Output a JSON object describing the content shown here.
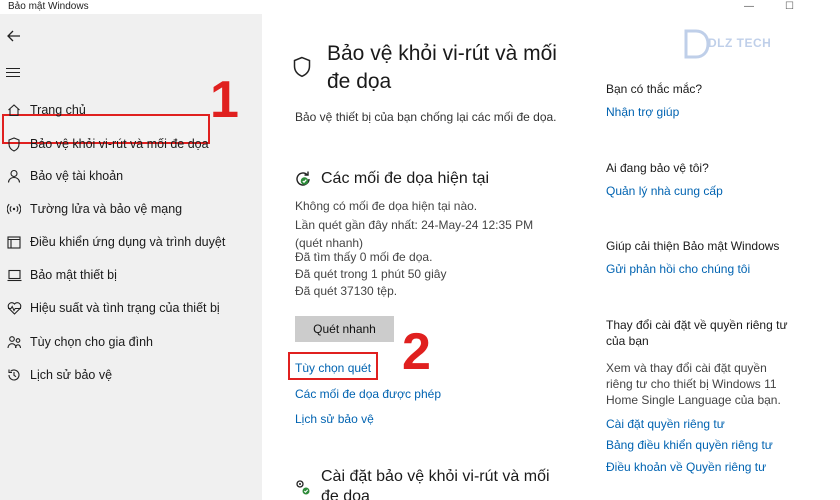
{
  "window": {
    "title": "Bảo mật Windows",
    "minimize": "—",
    "maximize": "☐"
  },
  "sidebar": {
    "items": [
      {
        "label": "Trang chủ",
        "icon": "home-icon"
      },
      {
        "label": "Bảo vệ khỏi vi-rút và mối đe dọa",
        "icon": "shield-icon"
      },
      {
        "label": "Bảo vệ tài khoản",
        "icon": "person-icon"
      },
      {
        "label": "Tường lửa và bảo vệ mạng",
        "icon": "wifi-icon"
      },
      {
        "label": "Điều khiển ứng dụng và trình duyệt",
        "icon": "app-browser-icon"
      },
      {
        "label": "Bảo mật thiết bị",
        "icon": "laptop-icon"
      },
      {
        "label": "Hiệu suất và tình trạng của thiết bị",
        "icon": "heart-icon"
      },
      {
        "label": "Tùy chọn cho gia đình",
        "icon": "family-icon"
      },
      {
        "label": "Lịch sử bảo vệ",
        "icon": "history-icon"
      }
    ],
    "active_index": 1
  },
  "annotations": {
    "step1": "1",
    "step2": "2",
    "color": "#e0201f"
  },
  "watermark": {
    "text": "DLZ TECH"
  },
  "main": {
    "title": "Bảo vệ khỏi vi-rút và mối đe dọa",
    "description": "Bảo vệ thiết bị của bạn chống lại các mối đe dọa.",
    "threats": {
      "heading": "Các mối đe dọa hiện tại",
      "lines": [
        "Không có mối đe dọa hiện tại nào.",
        "Lần quét gần đây nhất: 24-May-24 12:35 PM",
        "(quét nhanh)",
        "Đã tìm thấy 0 mối đe dọa.",
        "Đã quét trong 1 phút 50 giây",
        "Đã quét 37130 tệp."
      ],
      "quick_scan_button": "Quét nhanh",
      "scan_options_link": "Tùy chọn quét",
      "allowed_threats_link": "Các mối đe dọa được phép",
      "protection_history_link": "Lịch sử bảo vệ"
    },
    "settings_heading": "Cài đặt bảo vệ khỏi vi-rút và mối đe dọa"
  },
  "right": {
    "q1": {
      "heading": "Bạn có thắc mắc?",
      "link": "Nhận trợ giúp"
    },
    "q2": {
      "heading": "Ai đang bảo vệ tôi?",
      "link": "Quản lý nhà cung cấp"
    },
    "q3": {
      "heading": "Giúp cải thiện Bảo mật Windows",
      "link": "Gửi phản hồi cho chúng tôi"
    },
    "q4": {
      "heading": "Thay đổi cài đặt về quyền riêng tư của bạn",
      "text": "Xem và thay đổi cài đặt quyền riêng tư cho thiết bị Windows 11 Home Single Language của bạn.",
      "links": [
        "Cài đặt quyền riêng tư",
        "Bảng điều khiển quyền riêng tư",
        "Điều khoản về Quyền riêng tư"
      ]
    }
  },
  "colors": {
    "link": "#0063b1",
    "sidebar_bg": "#f0f0f0",
    "button_bg": "#cccccc"
  }
}
